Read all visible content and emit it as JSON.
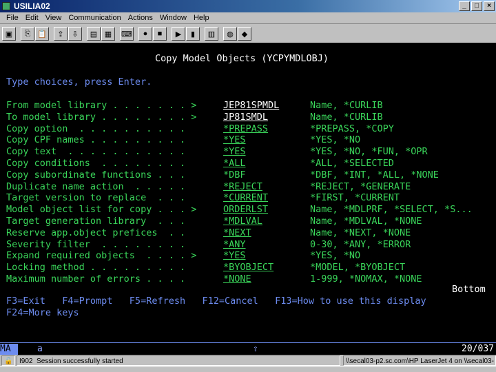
{
  "window": {
    "title": "USILIA02"
  },
  "menu": [
    "File",
    "Edit",
    "View",
    "Communication",
    "Actions",
    "Window",
    "Help"
  ],
  "toolbar_icons": [
    "print-screen-icon",
    "copy-icon",
    "paste-icon",
    "send-file-icon",
    "receive-file-icon",
    "display-setup-icon",
    "color-map-icon",
    "keyboard-map-icon",
    "record-macro-icon",
    "stop-macro-icon",
    "play-macro-icon",
    "pause-macro-icon",
    "clipboard-icon",
    "globe-icon",
    "help-icon"
  ],
  "screen": {
    "title": "Copy Model Objects (YCPYMDLOBJ)",
    "instruction": "Type choices, press Enter.",
    "rows": [
      {
        "label": "From model library . . . . . . . >",
        "value": "JEP81SPMDL",
        "hint": "Name, *CURLIB"
      },
      {
        "label": "To model library . . . . . . . . >",
        "value": "JP81SMDL",
        "hint": "Name, *CURLIB"
      },
      {
        "label": "Copy option  . . . . . . . . . .",
        "value": "*PREPASS",
        "hint": "*PREPASS, *COPY"
      },
      {
        "label": "Copy CPF names . . . . . . . . .",
        "value": "*YES",
        "hint": "*YES, *NO"
      },
      {
        "label": "Copy text  . . . . . . . . . . .",
        "value": "*YES",
        "hint": "*YES, *NO, *FUN, *OPR"
      },
      {
        "label": "Copy conditions  . . . . . . . .",
        "value": "*ALL",
        "hint": "*ALL, *SELECTED"
      },
      {
        "label": "Copy subordinate functions . . .",
        "value": "*DBF",
        "hint": "*DBF, *INT, *ALL, *NONE"
      },
      {
        "label": "Duplicate name action  . . . . .",
        "value": "*REJECT",
        "hint": "*REJECT, *GENERATE"
      },
      {
        "label": "Target version to replace  . . .",
        "value": "*CURRENT",
        "hint": "*FIRST, *CURRENT"
      },
      {
        "label": "Model object list for copy . . . >",
        "value": "ORDERLST",
        "hint": "Name, *MDLPRF, *SELECT, *S..."
      },
      {
        "label": "Target generation library  . . .",
        "value": "*MDLVAL",
        "hint": "Name, *MDLVAL, *NONE"
      },
      {
        "label": "Reserve app.object prefices  . .",
        "value": "*NEXT",
        "hint": "Name, *NEXT, *NONE"
      },
      {
        "label": "Severity filter  . . . . . . . .",
        "value": "*ANY",
        "hint": "0-30, *ANY, *ERROR"
      },
      {
        "label": "Expand required objects  . . . . >",
        "value": "*YES",
        "hint": "*YES, *NO"
      },
      {
        "label": "Locking method . . . . . . . . .",
        "value": "*BYOBJECT",
        "hint": "*MODEL, *BYOBJECT"
      },
      {
        "label": "Maximum number of errors . . . .",
        "value": "*NONE",
        "hint": "1-999, *NOMAX, *NONE"
      }
    ],
    "more": "Bottom",
    "fkeys1": "F3=Exit   F4=Prompt   F5=Refresh   F12=Cancel   F13=How to use this display",
    "fkeys2": "F24=More keys"
  },
  "oia": {
    "mode": "MA",
    "session": "a",
    "cursor": "20/037"
  },
  "statusbar": {
    "code": "I902",
    "message": "Session successfully started",
    "printer": "\\\\secal03-p2.sc.com\\HP LaserJet 4 on \\\\secal03-"
  }
}
